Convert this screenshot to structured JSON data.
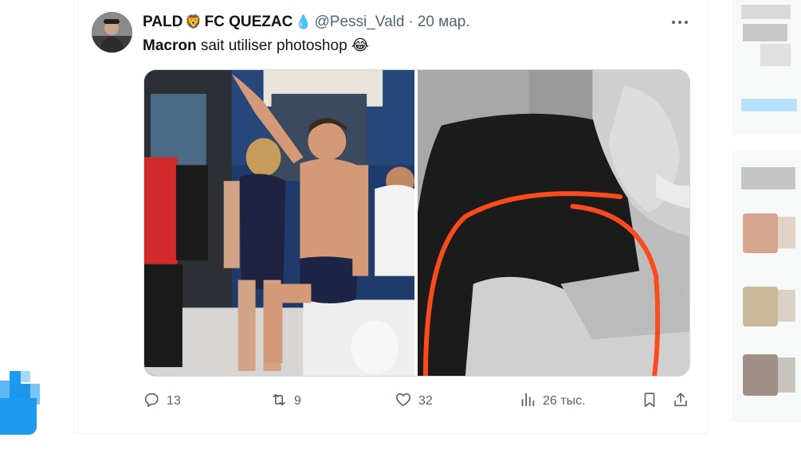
{
  "tweet": {
    "display_name": "PALD",
    "display_name_team": "FC QUEZAC",
    "handle": "@Pessi_Vald",
    "separator": "·",
    "timestamp": "20 мар.",
    "text_mention": "Macron",
    "text_body": " sait utiliser photoshop",
    "text_emoji": "😂",
    "name_emoji_1": "🦁",
    "name_emoji_2": "💧"
  },
  "actions": {
    "replies": "13",
    "reposts": "9",
    "likes": "32",
    "views": "26 тыс."
  },
  "icons": {
    "more": "more-dots-icon",
    "reply": "reply-icon",
    "repost": "repost-icon",
    "like": "heart-icon",
    "views": "views-chart-icon",
    "bookmark": "bookmark-icon",
    "share": "share-icon"
  },
  "colors": {
    "accent": "#1d9bf0",
    "muted": "#536471",
    "highlight_line": "#ff4a1c"
  }
}
